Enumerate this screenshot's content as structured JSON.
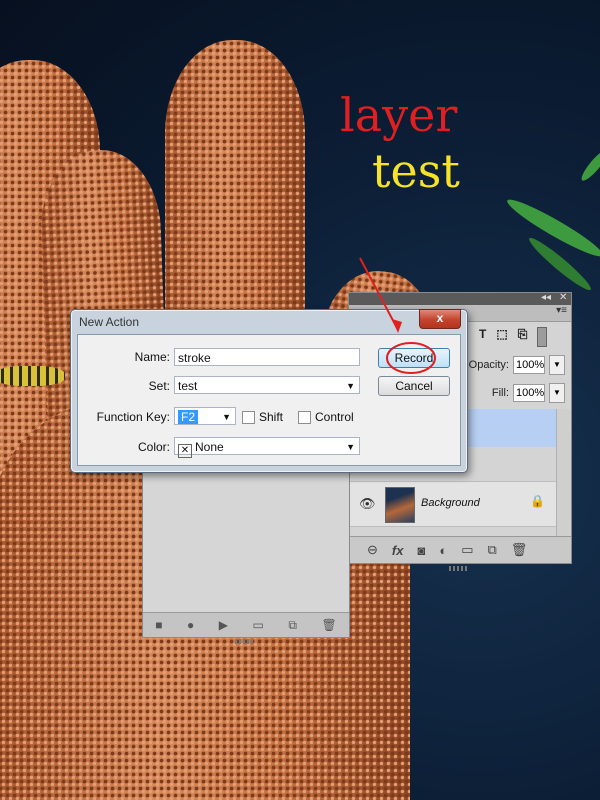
{
  "overlay_text": {
    "line1": "layer",
    "line2": "test",
    "line1_color": "#e02020",
    "line2_color": "#f5e229"
  },
  "dialog": {
    "title": "New Action",
    "close_label": "x",
    "name_label": "Name:",
    "name_value": "stroke",
    "set_label": "Set:",
    "set_value": "test",
    "function_key_label": "Function Key:",
    "function_key_value": "F2",
    "shift_label": "Shift",
    "control_label": "Control",
    "color_label": "Color:",
    "color_value": "None",
    "record_label": "Record",
    "cancel_label": "Cancel"
  },
  "layers_panel": {
    "opacity_label": "Opacity:",
    "opacity_value": "100%",
    "fill_label": "Fill:",
    "fill_value": "100%",
    "filter_icons": [
      "type-icon",
      "shape-icon",
      "smart-object-icon"
    ],
    "layers": [
      {
        "name": "Background",
        "visible": true,
        "locked": true
      }
    ],
    "footer_icons": [
      "link-icon",
      "fx-icon",
      "mask-icon",
      "adjustment-icon",
      "group-icon",
      "new-layer-icon",
      "trash-icon"
    ]
  },
  "actions_panel": {
    "footer_icons": [
      "stop-icon",
      "record-icon",
      "play-icon",
      "new-set-icon",
      "new-action-icon",
      "trash-icon"
    ]
  },
  "annotation": {
    "arrow_color": "#e02020",
    "circle_target": "Record"
  }
}
